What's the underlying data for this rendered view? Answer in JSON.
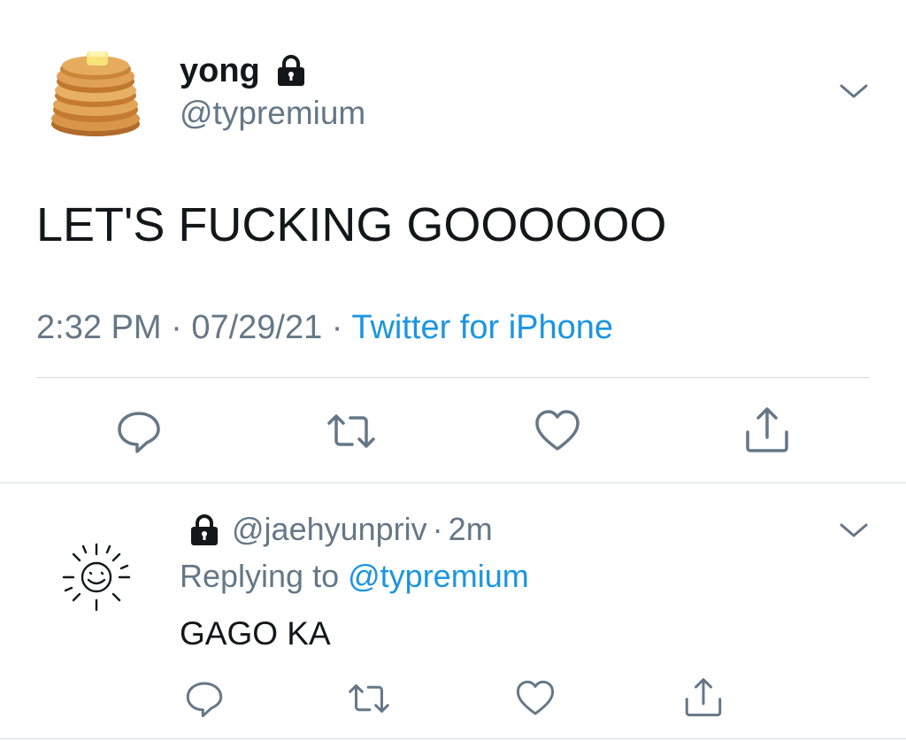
{
  "tweet": {
    "author_name": "yong",
    "author_handle": "@typremium",
    "text": "LET'S FUCKING GOOOOOO",
    "time": "2:32 PM",
    "date": "07/29/21",
    "source": "Twitter for iPhone",
    "separator": "·"
  },
  "reply": {
    "handle": "@jaehyunpriv",
    "separator": "·",
    "age": "2m",
    "replying_prefix": "Replying to",
    "replying_to": "@typremium",
    "text": "GAGO KA"
  },
  "colors": {
    "text": "#14171a",
    "muted": "#657786",
    "link": "#1b95e0",
    "divider": "#d3d9de",
    "icon": "#657786"
  },
  "icons": [
    "pancake-avatar",
    "lock-icon",
    "chevron-down-icon",
    "reply-icon",
    "retweet-icon",
    "like-icon",
    "share-icon",
    "sun-avatar"
  ]
}
